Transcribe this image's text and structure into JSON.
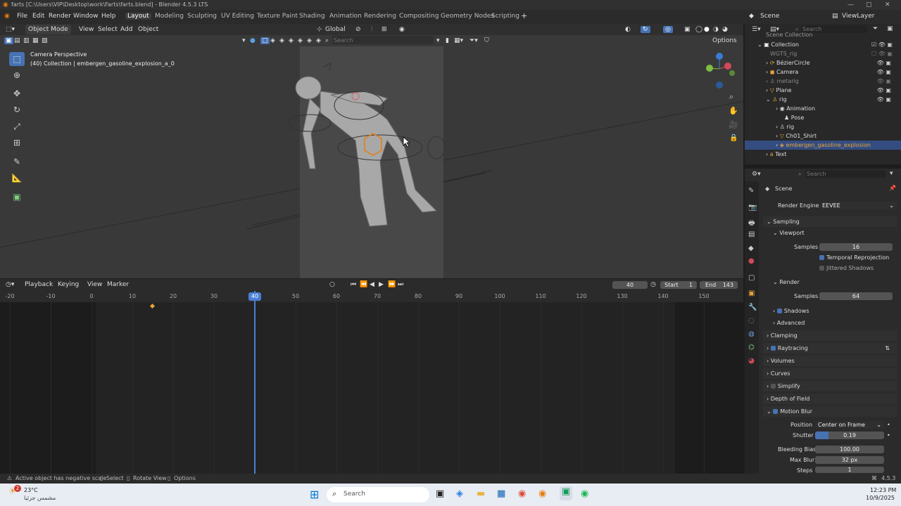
{
  "window": {
    "title": "farts [C:\\Users\\VIP\\Desktop\\work\\Farts\\farts.blend] - Blender 4.5.3 LTS"
  },
  "menu": [
    "File",
    "Edit",
    "Render",
    "Window",
    "Help"
  ],
  "workspaces": [
    "Layout",
    "Modeling",
    "Sculpting",
    "UV Editing",
    "Texture Paint",
    "Shading",
    "Animation",
    "Rendering",
    "Compositing",
    "Geometry Nodes",
    "Scripting"
  ],
  "scene_selector": "Scene",
  "viewlayer_selector": "ViewLayer",
  "viewport": {
    "mode": "Object Mode",
    "menus": [
      "View",
      "Select",
      "Add",
      "Object"
    ],
    "orientation": "Global",
    "search_placeholder": "Search",
    "options_label": "Options",
    "overlay_title": "Camera Perspective",
    "overlay_sub": "(40) Collection | embergen_gasoline_explosion_a_0"
  },
  "timeline": {
    "menus": [
      "Playback",
      "Keying",
      "View",
      "Marker"
    ],
    "current_frame": "40",
    "start_label": "Start",
    "start": "1",
    "end_label": "End",
    "end": "143",
    "ticks": [
      "-20",
      "-10",
      "0",
      "10",
      "20",
      "30",
      "40",
      "50",
      "60",
      "70",
      "80",
      "90",
      "100",
      "110",
      "120",
      "130",
      "140",
      "150"
    ]
  },
  "outliner": {
    "search_placeholder": "Search",
    "partial_top": "Scene Collection",
    "items": [
      "Collection",
      "WGTS_rig",
      "BézierCircle",
      "Camera",
      "metarig",
      "Plane",
      "rig",
      "Animation",
      "Pose",
      "rig",
      "Ch01_Shirt",
      "embergen_gasoline_explosion",
      "Text"
    ]
  },
  "properties": {
    "search_placeholder": "Search",
    "context": "Scene",
    "render_engine_label": "Render Engine",
    "render_engine": "EEVEE",
    "sampling": "Sampling",
    "viewport": "Viewport",
    "samples_label": "Samples",
    "viewport_samples": "16",
    "temporal_reprojection": "Temporal Reprojection",
    "jittered_shadows": "Jittered Shadows",
    "render": "Render",
    "render_samples": "64",
    "shadows": "Shadows",
    "advanced": "Advanced",
    "clamping": "Clamping",
    "raytracing": "Raytracing",
    "volumes": "Volumes",
    "curves": "Curves",
    "simplify": "Simplify",
    "depth_of_field": "Depth of Field",
    "motion_blur": "Motion Blur",
    "position_label": "Position",
    "position": "Center on Frame",
    "shutter_label": "Shutter",
    "shutter": "0.19",
    "shutter_fraction": 0.19,
    "bleeding_bias_label": "Bleeding Bias",
    "bleeding_bias": "100.00",
    "max_blur_label": "Max Blur",
    "max_blur": "32 px",
    "steps_label": "Steps",
    "steps": "1"
  },
  "status": {
    "message": "Active object has negative scale",
    "select": "Select",
    "rotate_view": "Rotate View",
    "options": "Options",
    "version": "4.5.3"
  },
  "taskbar": {
    "temperature": "23°C",
    "weather": "مشمس جزئيا",
    "search_placeholder": "Search",
    "time": "12:23 PM",
    "date": "10/9/2025",
    "notification_count": "2"
  },
  "colors": {
    "accent": "#4772b3",
    "selection": "#334d80",
    "playhead": "#4a7fd6",
    "keyframe": "#e8a33a"
  }
}
